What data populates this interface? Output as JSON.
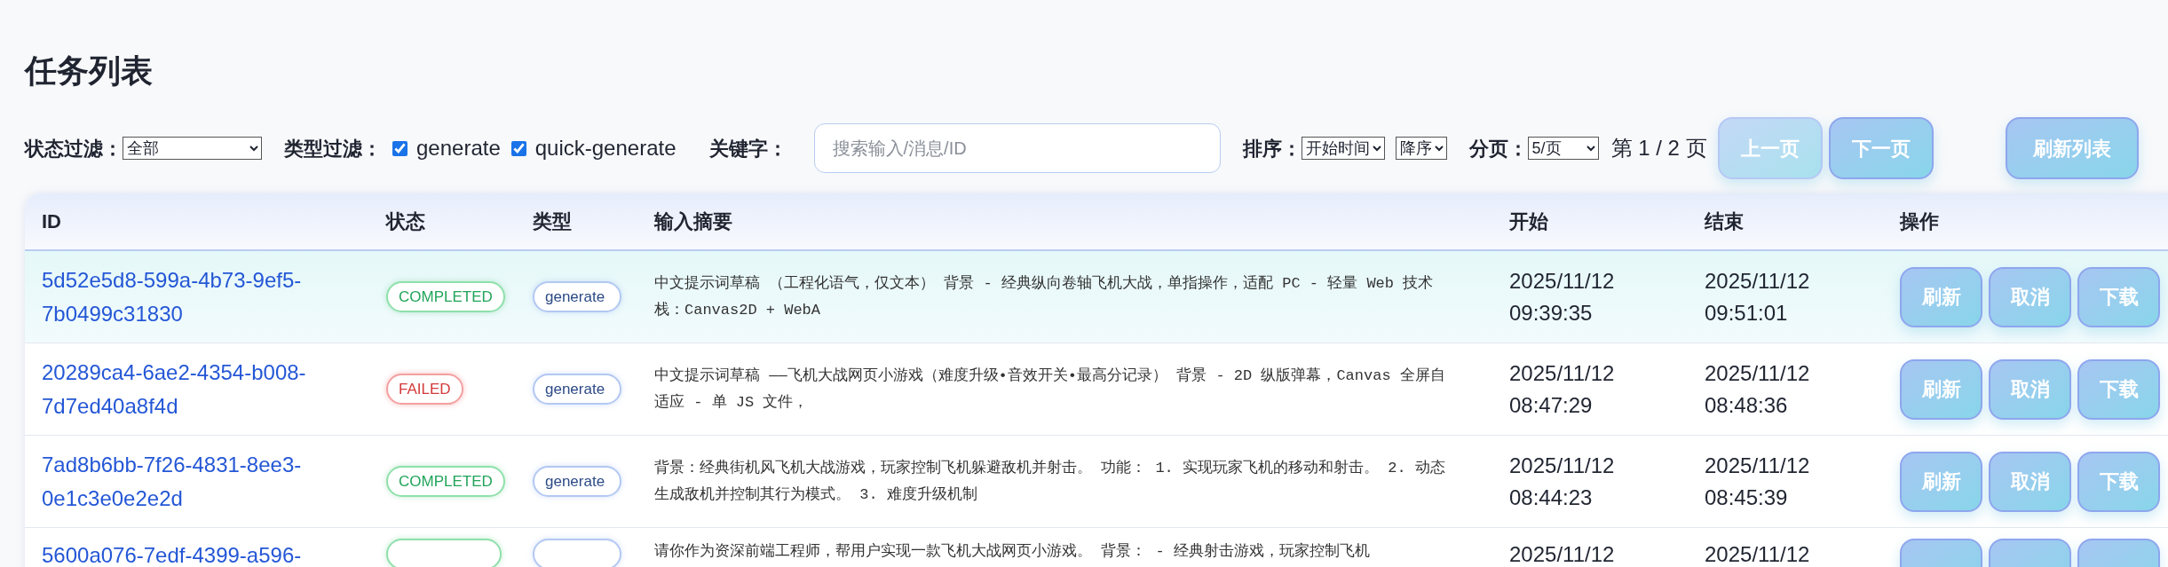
{
  "title": "任务列表",
  "filters": {
    "status_label": "状态过滤：",
    "status_value": "全部",
    "type_label": "类型过滤：",
    "types": [
      {
        "label": "generate",
        "checked": true
      },
      {
        "label": "quick-generate",
        "checked": true
      }
    ],
    "keyword_label": "关键字：",
    "keyword_placeholder": "搜索输入/消息/ID",
    "sort_label": "排序：",
    "sort_field": "开始时间",
    "sort_order": "降序",
    "page_label": "分页：",
    "page_size": "5/页",
    "page_info": "第 1 / 2 页",
    "buttons": [
      {
        "label": "上一页",
        "disabled": true
      },
      {
        "label": "下一页",
        "disabled": false
      },
      {
        "label": "刷新列表",
        "disabled": false
      }
    ]
  },
  "table": {
    "columns": [
      "ID",
      "状态",
      "类型",
      "输入摘要",
      "开始",
      "结束",
      "操作"
    ],
    "rows": [
      {
        "id": "5d52e5d8-599a-4b73-9ef5-7b0499c31830",
        "status": "COMPLETED",
        "kind": "completed",
        "type": "generate",
        "summary": "中文提示词草稿 （工程化语气，仅文本） 背景 - 经典纵向卷轴飞机大战，单指操作，适配 PC - 轻量 Web 技术栈：Canvas2D + WebA",
        "start": "2025/11/12 09:39:35",
        "end": "2025/11/12 09:51:01",
        "actions": [
          "刷新",
          "取消",
          "下载"
        ],
        "selected": true
      },
      {
        "id": "20289ca4-6ae2-4354-b008-7d7ed40a8f4d",
        "status": "FAILED",
        "kind": "failed",
        "type": "generate",
        "summary": "中文提示词草稿 ——飞机大战网页小游戏（难度升级•音效开关•最高分记录） 背景 - 2D 纵版弹幕，Canvas 全屏自适应 - 单 JS 文件，",
        "start": "2025/11/12 08:47:29",
        "end": "2025/11/12 08:48:36",
        "actions": [
          "刷新",
          "取消",
          "下载"
        ],
        "selected": false
      },
      {
        "id": "7ad8b6bb-7f26-4831-8ee3-0e1c3e0e2e2d",
        "status": "COMPLETED",
        "kind": "completed",
        "type": "generate",
        "summary": "背景：经典街机风飞机大战游戏，玩家控制飞机躲避敌机并射击。 功能： 1. 实现玩家飞机的移动和射击。 2. 动态生成敌机并控制其行为模式。 3. 难度升级机制",
        "start": "2025/11/12 08:44:23",
        "end": "2025/11/12 08:45:39",
        "actions": [
          "刷新",
          "取消",
          "下载"
        ],
        "selected": false
      },
      {
        "id": "5600a076-7edf-4399-a596-",
        "kind": "completed",
        "summary": "请你作为资深前端工程师，帮用户实现一款飞机大战网页小游戏。 背景： - 经典射击游戏，玩家控制飞机",
        "start": "2025/11/12",
        "end": "2025/11/12",
        "selected": false
      }
    ]
  }
}
